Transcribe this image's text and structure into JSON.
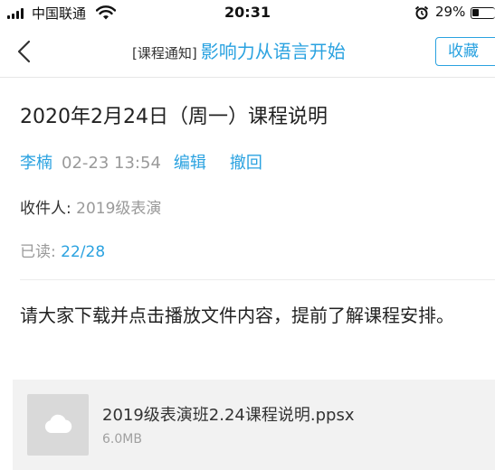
{
  "status_bar": {
    "carrier": "中国联通",
    "time": "20:31",
    "battery": "29%",
    "battery_level": 0.29
  },
  "nav": {
    "tag": "[课程通知]",
    "title": "影响力从语言开始",
    "favorite_label": "收藏"
  },
  "notice": {
    "title": "2020年2月24日（周一）课程说明",
    "author": "李楠",
    "time": "02-23 13:54",
    "edit_label": "编辑",
    "recall_label": "撤回",
    "recipient_label": "收件人: ",
    "recipient": "2019级表演",
    "read_label": "已读: ",
    "read_count": "22/28",
    "body": "请大家下载并点击播放文件内容，提前了解课程安排。"
  },
  "attachment": {
    "name": "2019级表演班2.24课程说明.ppsx",
    "size": "6.0MB",
    "icon": "cloud-icon"
  },
  "colors": {
    "accent": "#2aa2e0",
    "muted": "#9a9a9a"
  }
}
